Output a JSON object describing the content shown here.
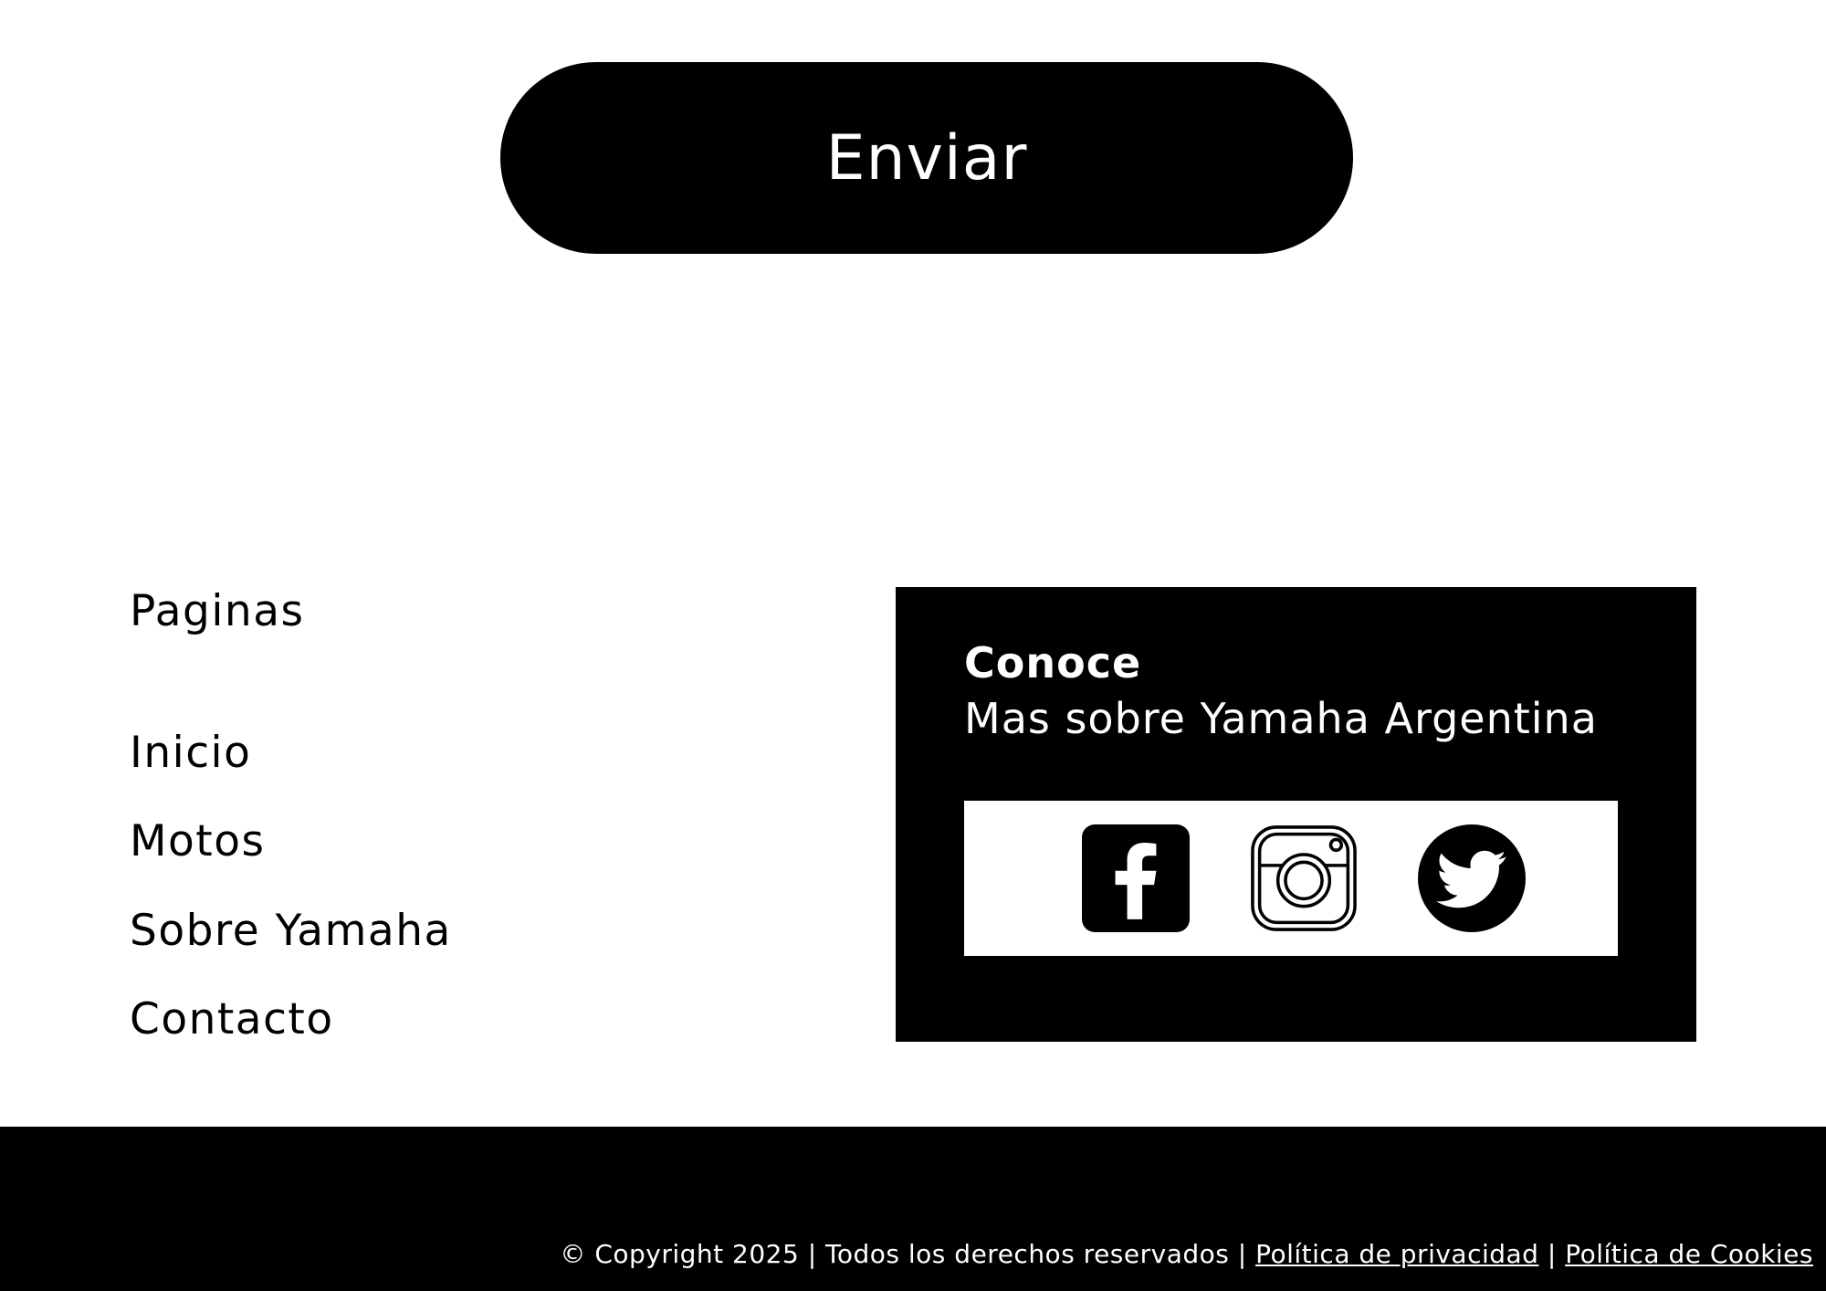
{
  "form": {
    "submit_label": "Enviar"
  },
  "pages": {
    "heading": "Paginas",
    "links": [
      "Inicio",
      "Motos",
      "Sobre Yamaha",
      "Contacto"
    ]
  },
  "social": {
    "title": "Conoce",
    "subtitle": "Mas sobre Yamaha Argentina",
    "icons": [
      "facebook-icon",
      "instagram-icon",
      "twitter-icon"
    ]
  },
  "footer": {
    "copyright": "© Copyright 2025 | Todos los derechos reservados | ",
    "privacy_label": "Política de privacidad",
    "separator": " | ",
    "cookies_label": "Política de Cookies"
  },
  "colors": {
    "background": "#ffffff",
    "primary": "#000000",
    "text_on_dark": "#ffffff"
  }
}
